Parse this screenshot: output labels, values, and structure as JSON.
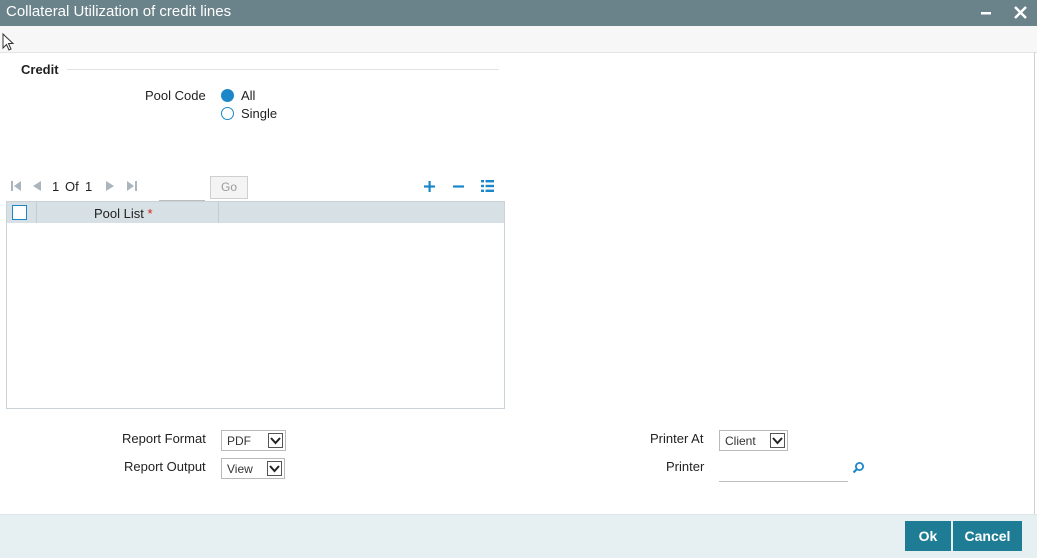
{
  "window": {
    "title": "Collateral Utilization of credit lines",
    "minimize_glyph": "▬",
    "close_glyph": "✕"
  },
  "section": {
    "title": "Credit"
  },
  "pool_code": {
    "label": "Pool Code",
    "options": [
      {
        "label": "All",
        "checked": true
      },
      {
        "label": "Single",
        "checked": false
      }
    ]
  },
  "pager": {
    "current": "1",
    "of_label": "Of",
    "total": "1",
    "go_label": "Go"
  },
  "grid": {
    "column_header": "Pool List",
    "required_marker": "*",
    "rows": []
  },
  "report": {
    "format_label": "Report Format",
    "format_value": "PDF",
    "output_label": "Report Output",
    "output_value": "View",
    "printer_at_label": "Printer At",
    "printer_at_value": "Client",
    "printer_label": "Printer",
    "printer_value": ""
  },
  "buttons": {
    "ok": "Ok",
    "cancel": "Cancel"
  },
  "colors": {
    "titlebar": "#6a8289",
    "accent": "#1b87c9",
    "button": "#1e7d94",
    "footer": "#e6eff2"
  }
}
